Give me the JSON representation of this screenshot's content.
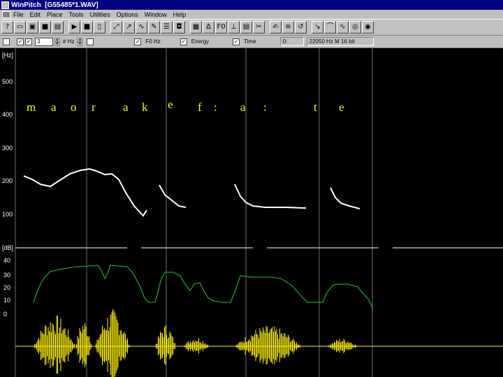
{
  "window": {
    "app": "WinPitch",
    "file": "[G55485*1.WAV]"
  },
  "menu": [
    "File",
    "Edit",
    "Place",
    "Tools",
    "Utilities",
    "Options",
    "Window",
    "Help"
  ],
  "toolbar": {
    "buttons": [
      {
        "name": "help",
        "glyph": "?"
      },
      {
        "name": "new",
        "glyph": "▭"
      },
      {
        "name": "open",
        "glyph": "▣"
      },
      {
        "name": "save",
        "glyph": "■"
      },
      {
        "name": "print",
        "glyph": "▤"
      },
      {
        "name": "play",
        "glyph": "▶"
      },
      {
        "name": "stop",
        "glyph": "■"
      },
      {
        "name": "mark",
        "glyph": "▯"
      },
      {
        "name": "zoom",
        "glyph": "⤢"
      },
      {
        "name": "pitch",
        "glyph": "↗"
      },
      {
        "name": "contour",
        "glyph": "∿"
      },
      {
        "name": "edit",
        "glyph": "✎"
      },
      {
        "name": "spectrum",
        "glyph": "☰"
      },
      {
        "name": "speaker",
        "glyph": "◘"
      },
      {
        "name": "analysis",
        "glyph": "▦"
      },
      {
        "name": "formant",
        "glyph": "∆"
      },
      {
        "name": "f0",
        "glyph": "F0"
      },
      {
        "name": "segment",
        "glyph": "⊥"
      },
      {
        "name": "label",
        "glyph": "▤"
      },
      {
        "name": "cut",
        "glyph": "✂"
      },
      {
        "name": "transcribe",
        "glyph": "✍"
      },
      {
        "name": "align",
        "glyph": "≡"
      },
      {
        "name": "loop",
        "glyph": "↺"
      },
      {
        "name": "measure",
        "glyph": "↘"
      },
      {
        "name": "synth",
        "glyph": "⌒"
      },
      {
        "name": "wave",
        "glyph": "∿"
      },
      {
        "name": "filter",
        "glyph": "◎"
      },
      {
        "name": "color",
        "glyph": "◉"
      }
    ]
  },
  "options": {
    "spin_value": "3",
    "hz_label": "# Hz",
    "check1": "F0 Hz",
    "check2": "Energy",
    "check3": "Time",
    "status1": "0:",
    "status2": "22050 Hz  M  16 bit"
  },
  "pitch_axis": {
    "unit": "[Hz]",
    "ticks": [
      "500",
      "400",
      "300",
      "200",
      "100"
    ]
  },
  "intensity_axis": {
    "unit": "[dB]",
    "ticks": [
      "40",
      "30",
      "20",
      "10",
      "0"
    ]
  },
  "transcription": [
    "m",
    "a",
    "o",
    "r",
    "a",
    "k",
    "e",
    "f",
    ":",
    "a",
    ":",
    "t",
    "e"
  ],
  "colors": {
    "pitch": "#ffffff",
    "intensity": "#1e9e1e",
    "waveform": "#fff200",
    "grid": "#707070",
    "label": "#fff200"
  },
  "pitch_curves": [
    [
      [
        34,
        183
      ],
      [
        46,
        188
      ],
      [
        58,
        195
      ],
      [
        72,
        198
      ],
      [
        86,
        189
      ],
      [
        100,
        180
      ],
      [
        115,
        175
      ],
      [
        128,
        173
      ],
      [
        138,
        176
      ],
      [
        150,
        181
      ],
      [
        160,
        180
      ],
      [
        170,
        188
      ],
      [
        180,
        207
      ],
      [
        192,
        226
      ],
      [
        205,
        240
      ],
      [
        210,
        232
      ]
    ],
    [
      [
        228,
        196
      ],
      [
        236,
        210
      ],
      [
        246,
        218
      ],
      [
        256,
        226
      ],
      [
        266,
        228
      ]
    ],
    [
      [
        336,
        195
      ],
      [
        344,
        212
      ],
      [
        352,
        221
      ],
      [
        362,
        226
      ],
      [
        380,
        228
      ],
      [
        410,
        228
      ],
      [
        438,
        229
      ]
    ],
    [
      [
        473,
        200
      ],
      [
        480,
        214
      ],
      [
        488,
        222
      ],
      [
        500,
        226
      ],
      [
        515,
        230
      ]
    ]
  ],
  "intensity_curve": [
    [
      48,
      364
    ],
    [
      52,
      352
    ],
    [
      58,
      338
    ],
    [
      64,
      328
    ],
    [
      72,
      320
    ],
    [
      90,
      316
    ],
    [
      110,
      313
    ],
    [
      128,
      312
    ],
    [
      140,
      311
    ],
    [
      145,
      318
    ],
    [
      150,
      330
    ],
    [
      155,
      320
    ],
    [
      158,
      311
    ],
    [
      168,
      312
    ],
    [
      182,
      313
    ],
    [
      190,
      322
    ],
    [
      200,
      340
    ],
    [
      206,
      356
    ],
    [
      212,
      364
    ],
    [
      222,
      364
    ],
    [
      226,
      350
    ],
    [
      230,
      333
    ],
    [
      236,
      321
    ],
    [
      248,
      321
    ],
    [
      258,
      326
    ],
    [
      266,
      340
    ],
    [
      272,
      347
    ],
    [
      278,
      338
    ],
    [
      286,
      336
    ],
    [
      292,
      348
    ],
    [
      298,
      358
    ],
    [
      306,
      362
    ],
    [
      318,
      364
    ],
    [
      330,
      364
    ],
    [
      338,
      344
    ],
    [
      344,
      326
    ],
    [
      352,
      327
    ],
    [
      362,
      328
    ],
    [
      388,
      328
    ],
    [
      402,
      330
    ],
    [
      418,
      340
    ],
    [
      432,
      356
    ],
    [
      440,
      364
    ],
    [
      462,
      364
    ],
    [
      468,
      350
    ],
    [
      476,
      340
    ],
    [
      484,
      338
    ],
    [
      498,
      338
    ],
    [
      512,
      342
    ],
    [
      520,
      352
    ],
    [
      528,
      360
    ],
    [
      534,
      375
    ]
  ]
}
